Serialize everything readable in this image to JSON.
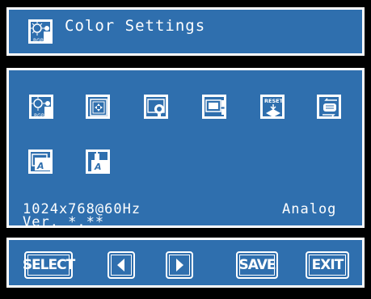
{
  "header": {
    "title": "Color Settings",
    "icon": "color-settings-icon"
  },
  "menu_icons": [
    {
      "name": "color-settings-icon",
      "label": "RGB"
    },
    {
      "name": "image-position-icon"
    },
    {
      "name": "image-adjust-icon"
    },
    {
      "name": "display-adjust-icon"
    },
    {
      "name": "reset-icon",
      "label": "RESET"
    },
    {
      "name": "input-select-icon"
    },
    {
      "name": "osd-settings-icon"
    },
    {
      "name": "advanced-settings-icon"
    }
  ],
  "info": {
    "resolution": "1024x768@60Hz",
    "signal": "Analog",
    "version": "Ver. *.**"
  },
  "buttons": {
    "select": "SELECT",
    "save": "SAVE",
    "exit": "EXIT"
  },
  "colors": {
    "panel": "#2f6fae",
    "border": "#ffffff",
    "background": "#000000"
  }
}
